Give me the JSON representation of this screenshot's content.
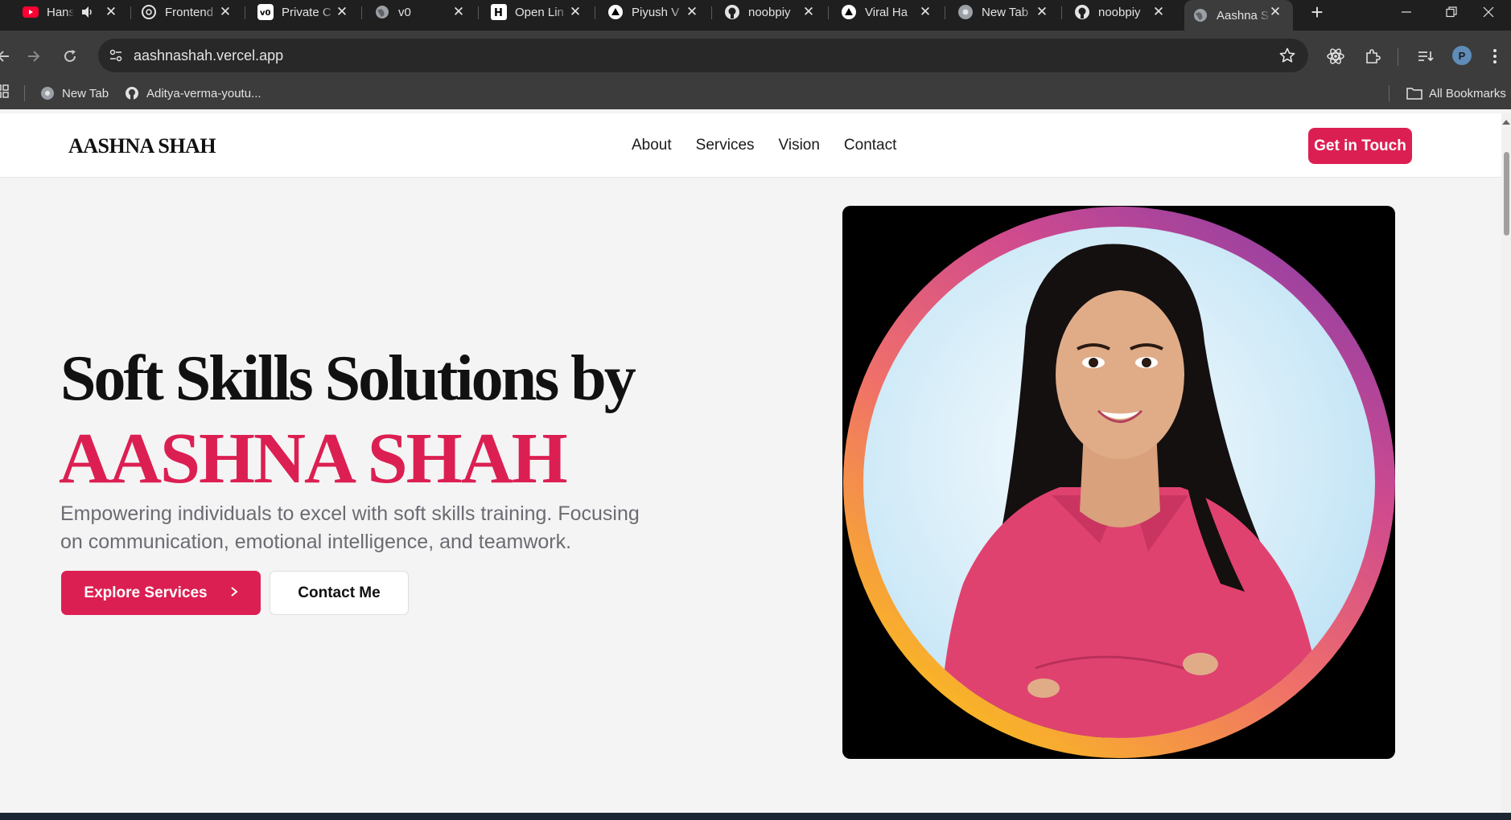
{
  "browser": {
    "tabs": [
      {
        "title": "Hans",
        "icon": "youtube-icon",
        "audio": true
      },
      {
        "title": "Frontend",
        "icon": "openai-icon"
      },
      {
        "title": "Private C",
        "icon": "v0-icon"
      },
      {
        "title": "v0",
        "icon": "globe-icon"
      },
      {
        "title": "Open Lin",
        "icon": "hashnode-icon"
      },
      {
        "title": "Piyush V",
        "icon": "vercel-icon"
      },
      {
        "title": "noobpiy",
        "icon": "github-icon"
      },
      {
        "title": "Viral Ha",
        "icon": "vercel-icon"
      },
      {
        "title": "New Tab",
        "icon": "chrome-icon"
      },
      {
        "title": "noobpiy",
        "icon": "github-icon"
      },
      {
        "title": "Aashna S",
        "icon": "globe-icon",
        "active": true
      }
    ],
    "address": "aashnashah.vercel.app",
    "profile_initial": "P",
    "bookmarks": [
      {
        "label": "New Tab",
        "icon": "chrome-icon"
      },
      {
        "label": "Aditya-verma-youtu...",
        "icon": "github-icon"
      }
    ],
    "all_bookmarks": "All Bookmarks"
  },
  "site": {
    "brand": "AASHNA SHAH",
    "nav": [
      "About",
      "Services",
      "Vision",
      "Contact"
    ],
    "cta": "Get in Touch",
    "hero": {
      "heading": "Soft Skills Solutions by",
      "name": "AASHNA SHAH",
      "description": "Empowering individuals to excel with soft skills training. Focusing on communication, emotional intelligence, and teamwork.",
      "primary_button": "Explore Services",
      "secondary_button": "Contact Me"
    }
  },
  "colors": {
    "accent": "#dc1f52",
    "chrome_dark": "#1f1f1f",
    "chrome_toolbar": "#3c3c3c"
  }
}
